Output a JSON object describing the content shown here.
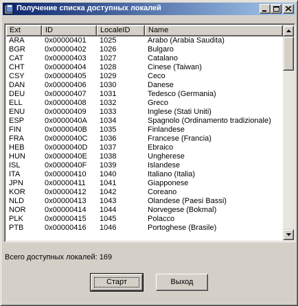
{
  "window": {
    "title": "Получение списка доступных локалей",
    "icon": "app-icon",
    "controls": [
      "minimize-icon",
      "maximize-icon",
      "close-icon"
    ]
  },
  "list": {
    "columns": [
      "Ext",
      "ID",
      "LocaleID",
      "Name"
    ],
    "rows": [
      [
        "ARA",
        "0x00000401",
        "1025",
        "Arabo (Arabia Saudita)"
      ],
      [
        "BGR",
        "0x00000402",
        "1026",
        "Bulgaro"
      ],
      [
        "CAT",
        "0x00000403",
        "1027",
        "Catalano"
      ],
      [
        "CHT",
        "0x00000404",
        "1028",
        "Cinese (Taiwan)"
      ],
      [
        "CSY",
        "0x00000405",
        "1029",
        "Ceco"
      ],
      [
        "DAN",
        "0x00000406",
        "1030",
        "Danese"
      ],
      [
        "DEU",
        "0x00000407",
        "1031",
        "Tedesco (Germania)"
      ],
      [
        "ELL",
        "0x00000408",
        "1032",
        "Greco"
      ],
      [
        "ENU",
        "0x00000409",
        "1033",
        "Inglese (Stati Uniti)"
      ],
      [
        "ESP",
        "0x0000040A",
        "1034",
        "Spagnolo (Ordinamento tradizionale)"
      ],
      [
        "FIN",
        "0x0000040B",
        "1035",
        "Finlandese"
      ],
      [
        "FRA",
        "0x0000040C",
        "1036",
        "Francese (Francia)"
      ],
      [
        "HEB",
        "0x0000040D",
        "1037",
        "Ebraico"
      ],
      [
        "HUN",
        "0x0000040E",
        "1038",
        "Ungherese"
      ],
      [
        "ISL",
        "0x0000040F",
        "1039",
        "Islandese"
      ],
      [
        "ITA",
        "0x00000410",
        "1040",
        "Italiano (Italia)"
      ],
      [
        "JPN",
        "0x00000411",
        "1041",
        "Giapponese"
      ],
      [
        "KOR",
        "0x00000412",
        "1042",
        "Coreano"
      ],
      [
        "NLD",
        "0x00000413",
        "1043",
        "Olandese (Paesi Bassi)"
      ],
      [
        "NOR",
        "0x00000414",
        "1044",
        "Norvegese (Bokmal)"
      ],
      [
        "PLK",
        "0x00000415",
        "1045",
        "Polacco"
      ],
      [
        "PTB",
        "0x00000416",
        "1046",
        "Portoghese (Brasile)"
      ]
    ]
  },
  "status": {
    "text": "Всего доступных локалей: 169"
  },
  "buttons": {
    "start": "Старт",
    "exit": "Выход"
  }
}
